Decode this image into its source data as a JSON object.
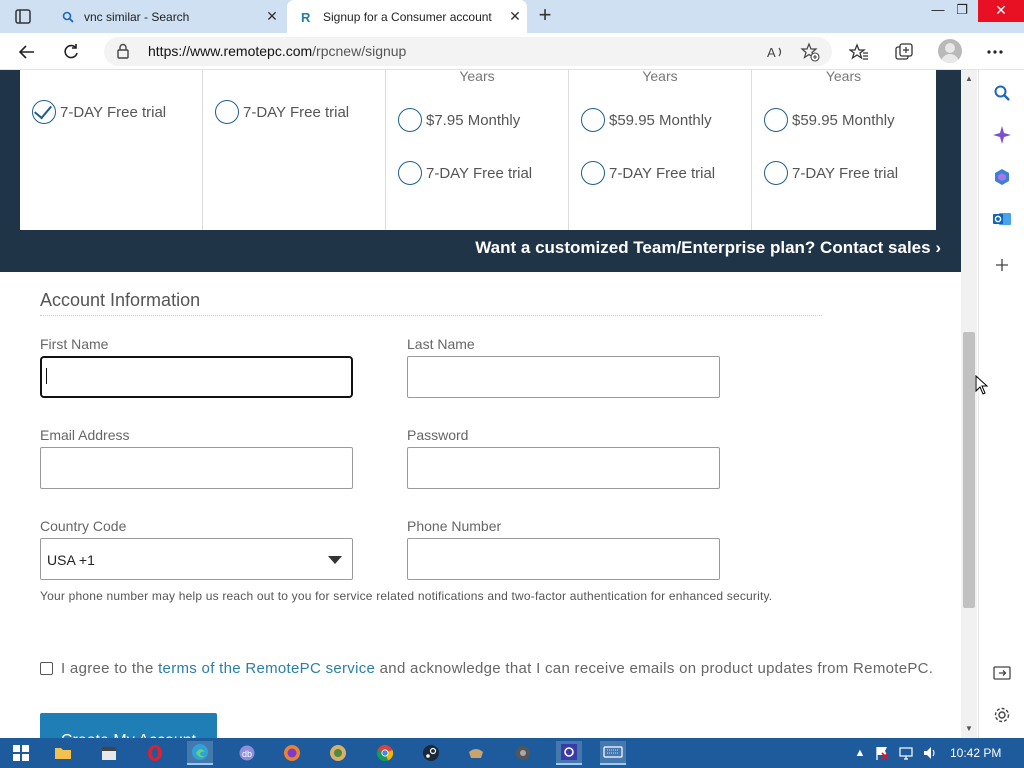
{
  "browser": {
    "tabs": [
      {
        "title": "vnc similar - Search",
        "active": false
      },
      {
        "title": "Signup for a Consumer account",
        "active": true
      }
    ],
    "url_host": "https://www.remotepc.com",
    "url_path": "/rpcnew/signup"
  },
  "plans": {
    "years_label": "Years",
    "columns": [
      {
        "years": "",
        "options": [
          {
            "label": "7-DAY Free trial",
            "checked": true
          }
        ]
      },
      {
        "years": "",
        "options": [
          {
            "label": "7-DAY Free trial",
            "checked": false
          }
        ]
      },
      {
        "years": "Years",
        "options": [
          {
            "label": "$7.95 Monthly",
            "checked": false
          },
          {
            "label": "7-DAY Free trial",
            "checked": false
          }
        ]
      },
      {
        "years": "Years",
        "options": [
          {
            "label": "$59.95 Monthly",
            "checked": false
          },
          {
            "label": "7-DAY Free trial",
            "checked": false
          }
        ]
      },
      {
        "years": "Years",
        "options": [
          {
            "label": "$59.95 Monthly",
            "checked": false
          },
          {
            "label": "7-DAY Free trial",
            "checked": false
          }
        ]
      }
    ],
    "contact_sales": "Want a customized Team/Enterprise plan? Contact sales"
  },
  "account": {
    "title": "Account Information",
    "first_name_label": "First Name",
    "first_name_value": "",
    "last_name_label": "Last Name",
    "last_name_value": "",
    "email_label": "Email Address",
    "email_value": "",
    "password_label": "Password",
    "password_value": "",
    "country_code_label": "Country Code",
    "country_code_value": "USA +1",
    "phone_label": "Phone Number",
    "phone_value": "",
    "phone_help": "Your phone number may help us reach out to you for service related notifications and two-factor authentication for enhanced security.",
    "agree_prefix": "I agree to the",
    "agree_link": "terms of the RemotePC service",
    "agree_suffix": "and acknowledge that I can receive emails on product updates from RemotePC.",
    "agree_checked": false,
    "submit_label": "Create My Account"
  },
  "taskbar": {
    "clock": "10:42 PM"
  },
  "colors": {
    "band": "#203448",
    "accent": "#1f7eb6",
    "link": "#2a7fa8",
    "radio": "#1e5f8a"
  }
}
